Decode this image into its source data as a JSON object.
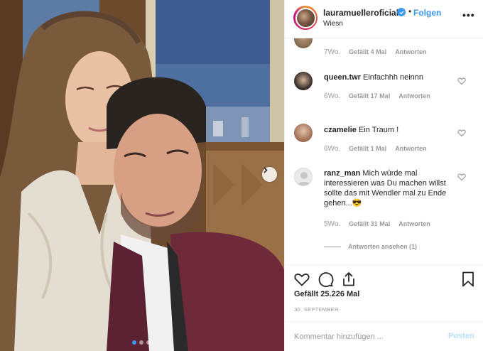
{
  "header": {
    "username": "lauramuelleroficial",
    "follow_label": "Folgen",
    "separator": "•",
    "location": "Wiesn"
  },
  "comments": [
    {
      "username": "",
      "text": "",
      "time": "7Wo.",
      "likes": "Gefällt 4 Mal",
      "reply": "Antworten"
    },
    {
      "username": "queen.twr",
      "text": "Einfachhh neinnn",
      "time": "6Wo.",
      "likes": "Gefällt 17 Mal",
      "reply": "Antworten"
    },
    {
      "username": "czamelie",
      "text": "Ein Traum !",
      "time": "6Wo.",
      "likes": "Gefällt 1 Mal",
      "reply": "Antworten"
    },
    {
      "username": "ranz_man",
      "text": "Mich würde mal interessieren was Du machen willst sollte das mit Wendler mal zu Ende gehen...😎",
      "time": "5Wo.",
      "likes": "Gefällt 31 Mal",
      "reply": "Antworten"
    }
  ],
  "view_replies": "Antworten ansehen (1)",
  "likes_count": "Gefällt 25.226 Mal",
  "post_date": "30. SEPTEMBER",
  "comment_input": {
    "placeholder": "Kommentar hinzufügen ...",
    "value": ""
  },
  "post_button": "Posten",
  "carousel": {
    "total": 3,
    "active": 1
  },
  "colors": {
    "accent": "#3897f0",
    "muted": "#999999",
    "post_disabled": "#b2dffc"
  },
  "icons": [
    "heart-icon",
    "comment-icon",
    "share-icon",
    "bookmark-icon",
    "more-icon",
    "verified-icon",
    "chevron-right-icon"
  ]
}
